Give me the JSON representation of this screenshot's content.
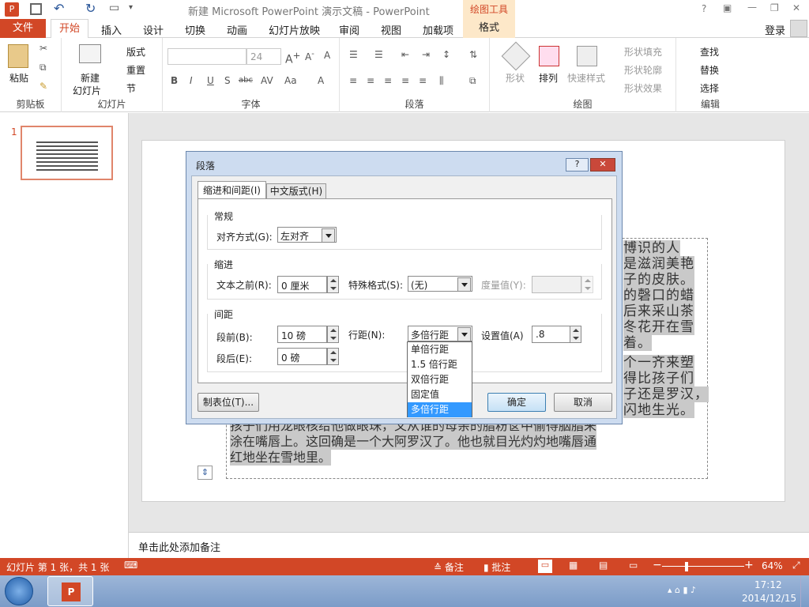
{
  "window": {
    "title": "新建 Microsoft PowerPoint 演示文稿 - PowerPoint",
    "context_tab": "绘图工具",
    "login": "登录"
  },
  "tabs": [
    "文件",
    "开始",
    "插入",
    "设计",
    "切换",
    "动画",
    "幻灯片放映",
    "审阅",
    "视图",
    "加载项",
    "格式"
  ],
  "ribbon": {
    "clipboard": {
      "label": "剪贴板",
      "paste": "粘贴"
    },
    "slides": {
      "label": "幻灯片",
      "new_slide": "新建",
      "new_slide2": "幻灯片",
      "layout": "版式",
      "reset": "重置",
      "section": "节"
    },
    "font": {
      "label": "字体",
      "size": "24"
    },
    "paragraph": {
      "label": "段落"
    },
    "drawing": {
      "label": "绘图",
      "shape": "形状",
      "arrange": "排列",
      "quick_style": "快速样式",
      "fill": "形状填充",
      "outline": "形状轮廓",
      "effect": "形状效果"
    },
    "editing": {
      "label": "编辑",
      "find": "查找",
      "replace": "替换",
      "select": "选择"
    }
  },
  "thumb": {
    "number": "1"
  },
  "notes": {
    "placeholder": "单击此处添加备注"
  },
  "slide_text": {
    "lines": [
      "博识的人",
      "是滋润美艳",
      "子的皮肤。",
      "的磬口的蜡",
      "后来采山茶",
      "冬花开在雪",
      "着。",
      "个一齐来塑",
      "得比孩子们",
      "子还是罗汉，",
      "闪地生光。",
      "孩子们用龙眼核给他做眼珠，又从谁的母亲的脂粉奁中偷得胭脂来",
      "涂在嘴唇上。这回确是一个大阿罗汉了。他也就目光灼灼地嘴唇通",
      "红地坐在雪地里。"
    ]
  },
  "dialog": {
    "title": "段落",
    "tab1": "缩进和间距(I)",
    "tab2": "中文版式(H)",
    "general": {
      "heading": "常规",
      "align_label": "对齐方式(G):",
      "align_value": "左对齐"
    },
    "indent": {
      "heading": "缩进",
      "before_label": "文本之前(R):",
      "before_value": "0 厘米",
      "special_label": "特殊格式(S):",
      "special_value": "(无)",
      "measure_label": "度量值(Y):"
    },
    "spacing": {
      "heading": "间距",
      "before_label": "段前(B):",
      "before_value": "10 磅",
      "after_label": "段后(E):",
      "after_value": "0 磅",
      "line_label": "行距(N):",
      "line_value": "多倍行距",
      "setting_label": "设置值(A)",
      "setting_value": ".8"
    },
    "options": [
      "单倍行距",
      "1.5 倍行距",
      "双倍行距",
      "固定值",
      "多倍行距"
    ],
    "tabs_btn": "制表位(T)...",
    "ok": "确定",
    "cancel": "取消"
  },
  "status": {
    "slide_info": "幻灯片 第 1 张，共 1 张",
    "notes": "备注",
    "comments": "批注",
    "zoom": "64%"
  },
  "taskbar": {
    "time": "17:12",
    "date": "2014/12/15"
  },
  "colors": {
    "accent": "#d24726",
    "dialog_sel": "#3399ff"
  }
}
